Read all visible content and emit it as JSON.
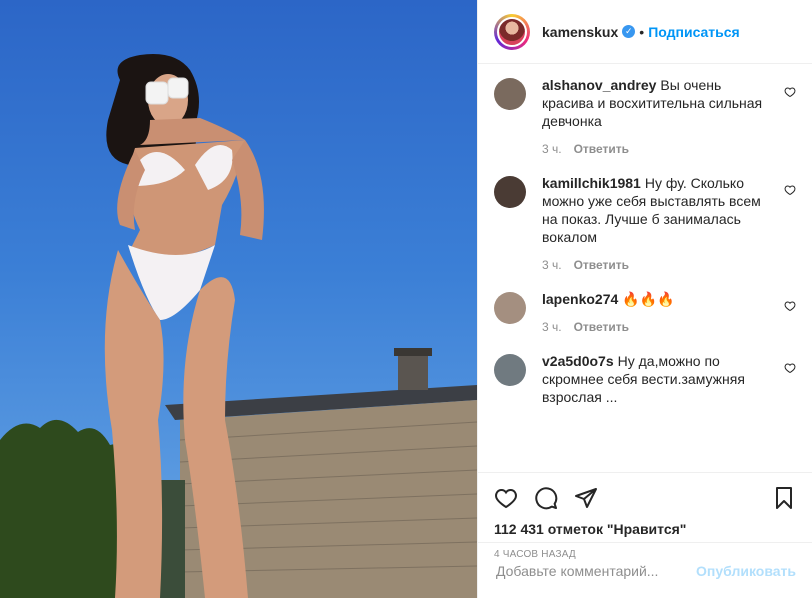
{
  "header": {
    "username": "kamenskux",
    "follow_label": "Подписаться"
  },
  "comments": [
    {
      "user": "alshanov_andrey",
      "text": "Вы очень красива и восхитительна сильная девчонка",
      "time": "3 ч.",
      "reply": "Ответить",
      "avatar_color": "#7a6a5e"
    },
    {
      "user": "kamillchik1981",
      "text": "Ну фу. Сколько можно уже себя выставлять всем на показ. Лучше б занималась вокалом",
      "time": "3 ч.",
      "reply": "Ответить",
      "avatar_color": "#4a3b34"
    },
    {
      "user": "lapenko274",
      "text": "🔥🔥🔥",
      "time": "3 ч.",
      "reply": "Ответить",
      "avatar_color": "#a48f80"
    },
    {
      "user": "v2a5d0o7s",
      "text": "Ну да,можно по скромнее себя вести.замужняя взрослая ...",
      "time": "",
      "reply": "",
      "avatar_color": "#707a80"
    }
  ],
  "actions": {
    "likes": "112 431 отметок \"Нравится\"",
    "time": "4 часов назад"
  },
  "add_comment": {
    "placeholder": "Добавьте комментарий...",
    "publish_label": "Опубликовать"
  },
  "icons": [
    "heart-icon",
    "comment-icon",
    "share-icon",
    "bookmark-icon"
  ],
  "colors": {
    "accent": "#0095f6",
    "verified": "#3897f0",
    "publish_disabled": "#b2dffc"
  }
}
